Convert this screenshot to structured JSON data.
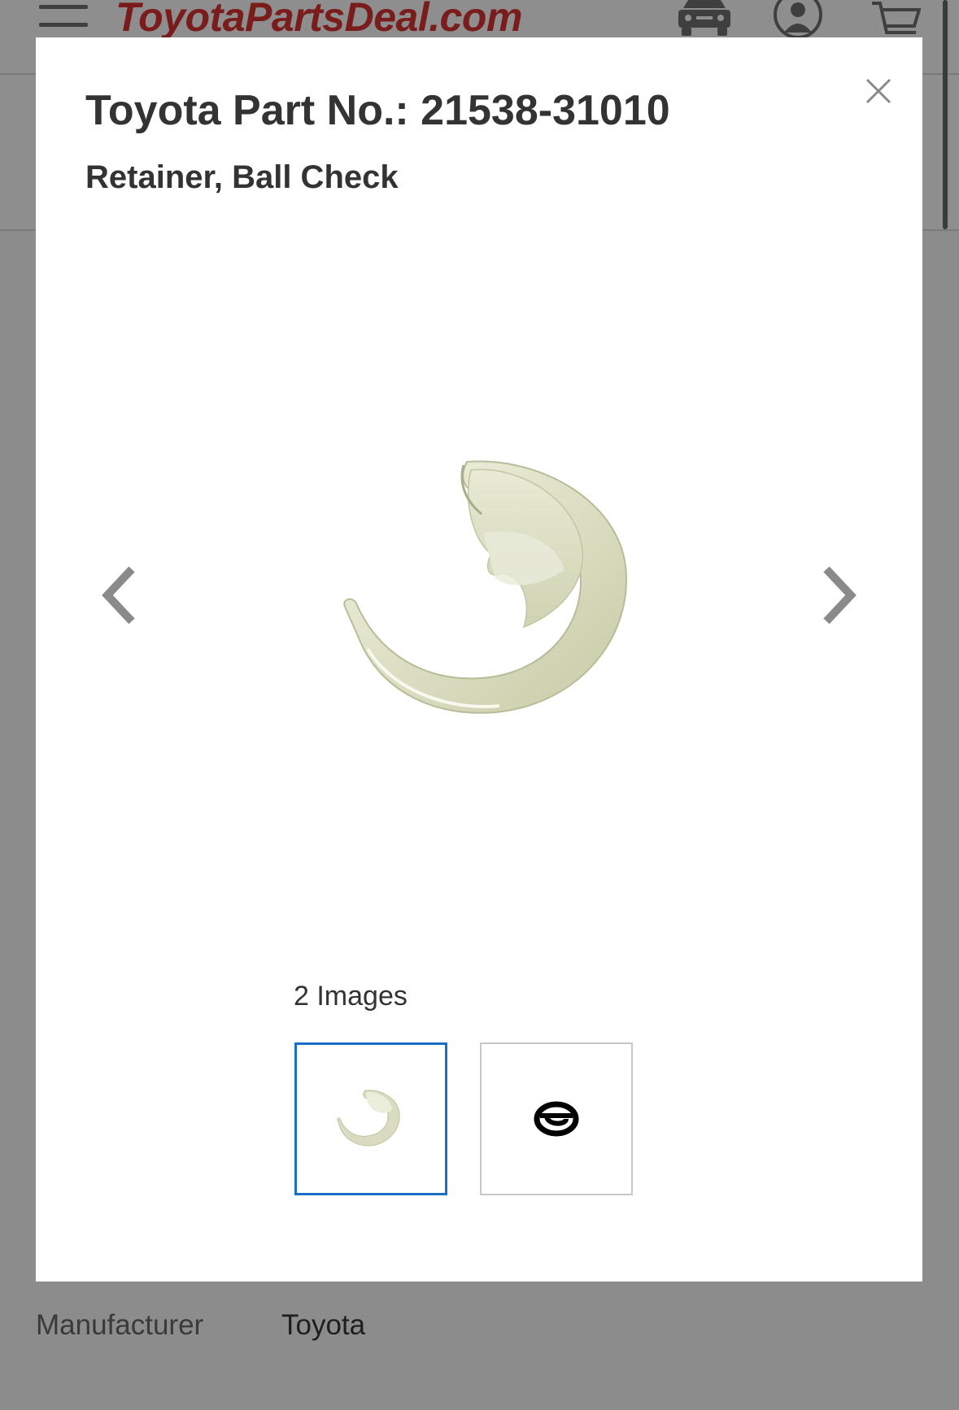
{
  "site": {
    "logo_text": "ToyotaPartsDeal.com",
    "icons": [
      "menu-icon",
      "vehicle-icon",
      "account-icon",
      "cart-icon"
    ]
  },
  "modal": {
    "title": "Toyota Part No.: 21538-31010",
    "subtitle": "Retainer, Ball Check",
    "image_count": "2 Images",
    "selected_thumbnail": 1,
    "thumbnails": [
      {
        "icon": "retainer-photo"
      },
      {
        "icon": "diagram-symbol"
      }
    ],
    "accent_color": "#1a6fc9"
  },
  "attributes": [
    {
      "label": "Manufacturer",
      "value": "Toyota"
    }
  ]
}
